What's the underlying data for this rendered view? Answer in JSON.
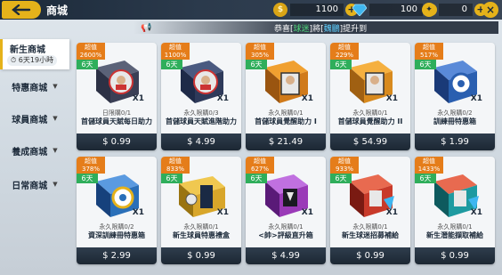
{
  "header": {
    "back_icon": "back-arrow-icon",
    "title": "商城",
    "coins": "1100",
    "diamonds": "100",
    "tickets": "0",
    "close_label": "×"
  },
  "announcement": {
    "prefix": "恭喜",
    "player": "球迷",
    "mid": "將",
    "item": "魏鵬",
    "suffix": "提升到"
  },
  "sidebar": {
    "active": {
      "label": "新生商城",
      "timer": "6天19小時"
    },
    "items": [
      {
        "label": "特惠商城"
      },
      {
        "label": "球員商城"
      },
      {
        "label": "養成商城"
      },
      {
        "label": "日常商城"
      }
    ]
  },
  "products": [
    {
      "badge_top": "超值",
      "badge_pct": "2600%",
      "days": "6天",
      "qty": "X1",
      "sub": "日限購0/1",
      "name": "首儲球員天賦每日助力",
      "price": "$ 0.99",
      "color": "#3a3f55"
    },
    {
      "badge_top": "超值",
      "badge_pct": "1100%",
      "days": "6天",
      "qty": "X1",
      "sub": "永久限購0/3",
      "name": "首儲球員天賦進階助力",
      "price": "$ 4.99",
      "color": "#2e3a5a"
    },
    {
      "badge_top": "超值",
      "badge_pct": "305%",
      "days": "6天",
      "qty": "X1",
      "sub": "永久限購0/1",
      "name": "首儲球員覺醒助力 I",
      "price": "$ 21.49",
      "color": "#d07a1a"
    },
    {
      "badge_top": "超值",
      "badge_pct": "229%",
      "days": "6天",
      "qty": "X1",
      "sub": "永久限購0/1",
      "name": "首儲球員覺醒助力 II",
      "price": "$ 54.99",
      "color": "#d88a1e"
    },
    {
      "badge_top": "超值",
      "badge_pct": "517%",
      "days": "6天",
      "qty": "X1",
      "sub": "永久限購0/2",
      "name": "訓練冊特惠箱",
      "price": "$ 1.99",
      "color": "#2a5fb0"
    },
    {
      "badge_top": "超值",
      "badge_pct": "378%",
      "days": "6天",
      "qty": "X1",
      "sub": "永久限購0/2",
      "name": "資深訓練冊特惠箱",
      "price": "$ 2.99",
      "color": "#2a6fb8"
    },
    {
      "badge_top": "超值",
      "badge_pct": "833%",
      "days": "6天",
      "qty": "X1",
      "sub": "永久限購0/1",
      "name": "新生球員特惠禮盒",
      "price": "$ 0.99",
      "color": "#d8a62a"
    },
    {
      "badge_top": "超值",
      "badge_pct": "627%",
      "days": "6天",
      "qty": "X1",
      "sub": "永久限購0/1",
      "name": "<帥>評級直升箱",
      "price": "$ 4.99",
      "color": "#9a3ab8"
    },
    {
      "badge_top": "超值",
      "badge_pct": "933%",
      "days": "6天",
      "qty": "X1",
      "sub": "永久限購0/1",
      "name": "新生球迷招募補給",
      "price": "$ 0.99",
      "color": "#c83a2a"
    },
    {
      "badge_top": "超值",
      "badge_pct": "1433%",
      "days": "6天",
      "qty": "X1",
      "sub": "永久限購0/1",
      "name": "新生潛能擷取補給",
      "price": "$ 0.99",
      "color": "#1e9aa0"
    }
  ]
}
